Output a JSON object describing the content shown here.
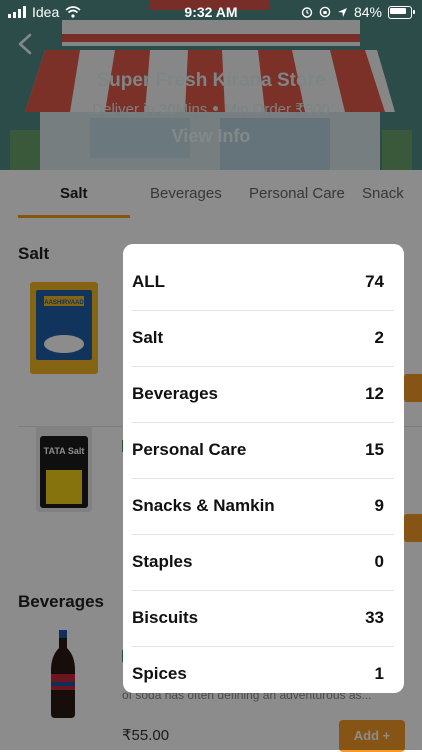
{
  "status_bar": {
    "carrier": "Idea",
    "time": "9:32 AM",
    "battery": "84%",
    "icons": [
      "signal-bars-icon",
      "wifi-icon",
      "alarm-icon",
      "lock-rotation-icon",
      "location-arrow-icon",
      "battery-icon"
    ]
  },
  "header": {
    "store_name": "Super Fresh Kirana Store",
    "delivery": "Deliver in 30Mins",
    "min_order": "Min Order ₹300",
    "view_info": "View Info",
    "colors": {
      "background": "#4f8a86",
      "awning_red": "#e0584a"
    }
  },
  "tabs": [
    {
      "label": "Salt",
      "active": true
    },
    {
      "label": "Beverages",
      "active": false
    },
    {
      "label": "Personal Care",
      "active": false
    },
    {
      "label": "Snack",
      "active": false
    }
  ],
  "sections": [
    {
      "title": "Salt",
      "products": [
        {
          "image": "aashirvaad-salt-pack",
          "brand_text": "AASHIRVAAD"
        },
        {
          "image": "tata-salt-pack",
          "brand_text": "TATA Salt"
        }
      ]
    },
    {
      "title": "Beverages",
      "products": [
        {
          "image": "cola-bottle",
          "description": "of soda has often defining an adventurous as...",
          "price": "₹55.00",
          "add_label": "Add +"
        }
      ]
    }
  ],
  "category_popup": {
    "items": [
      {
        "name": "ALL",
        "count": "74"
      },
      {
        "name": "Salt",
        "count": "2"
      },
      {
        "name": "Beverages",
        "count": "12"
      },
      {
        "name": "Personal Care",
        "count": "15"
      },
      {
        "name": "Snacks & Namkin",
        "count": "9"
      },
      {
        "name": "Staples",
        "count": "0"
      },
      {
        "name": "Biscuits",
        "count": "33"
      },
      {
        "name": "Spices",
        "count": "1"
      }
    ]
  },
  "colors": {
    "accent": "#f59a26",
    "veg_mark": "#3a9b4a"
  }
}
